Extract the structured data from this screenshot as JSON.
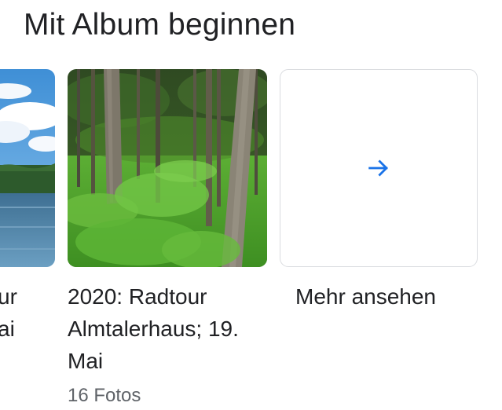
{
  "section": {
    "title": "Mit Album beginnen"
  },
  "albums": [
    {
      "title_lines": [
        "ur",
        "ai"
      ]
    },
    {
      "title_lines": [
        "2020: Radtour",
        "Almtalerhaus; 19.",
        "Mai"
      ],
      "count": "16 Fotos"
    }
  ],
  "more": {
    "label": "Mehr ansehen",
    "icon": "arrow-right-icon",
    "accent": "#1a73e8"
  }
}
